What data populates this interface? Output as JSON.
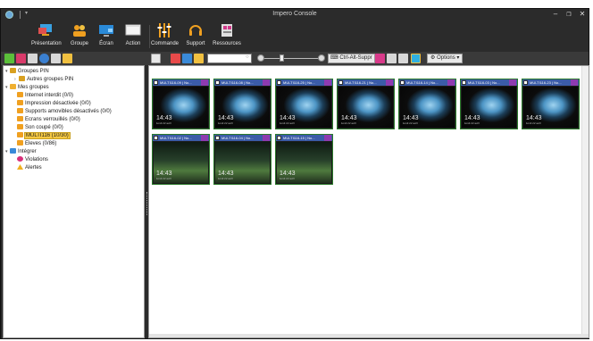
{
  "window": {
    "title": "Impero Console",
    "menu_glyph": "▾",
    "minimize": "–",
    "restore": "❐",
    "close": "✕"
  },
  "ribbon": {
    "buttons": [
      {
        "label": "Présentation",
        "icon": "presentation-icon"
      },
      {
        "label": "Groupe",
        "icon": "group-icon"
      },
      {
        "label": "Écran",
        "icon": "screen-icon"
      },
      {
        "label": "Action",
        "icon": "action-icon"
      },
      {
        "label": "Commande",
        "icon": "command-icon"
      },
      {
        "label": "Support",
        "icon": "support-headset-icon"
      },
      {
        "label": "Ressources",
        "icon": "resources-icon"
      }
    ]
  },
  "toolbar": {
    "ctrl_alt_label": "Ctrl-Alt-Suppr",
    "options_label": "Options",
    "options_caret": "▾",
    "search_placeholder": "",
    "search_clear": "○"
  },
  "tree": {
    "items": [
      {
        "label": "Groupes PIN",
        "level": 0,
        "expanded": true,
        "icon": "pin-group-icon"
      },
      {
        "label": "Autres groupes PIN",
        "level": 1,
        "expanded": false,
        "icon": "pin-group-icon"
      },
      {
        "label": "Mes groupes",
        "level": 0,
        "expanded": true,
        "icon": "folder-group-icon"
      },
      {
        "label": "Internet interdit (0/0)",
        "level": 1,
        "icon": "group-users-icon"
      },
      {
        "label": "Impression désactivée (0/0)",
        "level": 1,
        "icon": "group-users-icon"
      },
      {
        "label": "Supports amovibles désactivés (0/0)",
        "level": 1,
        "icon": "group-users-icon"
      },
      {
        "label": "Ecrans verrouillés (0/0)",
        "level": 1,
        "icon": "group-users-icon"
      },
      {
        "label": "Son coupé (0/0)",
        "level": 1,
        "icon": "group-users-icon"
      },
      {
        "label": "MULTI116 (10/30)",
        "level": 1,
        "icon": "group-users-icon",
        "selected": true
      },
      {
        "label": "Eleves (0/86)",
        "level": 1,
        "icon": "group-users-icon"
      },
      {
        "label": "Intégrer",
        "level": 0,
        "expanded": true,
        "icon": "integrate-icon"
      },
      {
        "label": "Violations",
        "level": 1,
        "icon": "violation-icon"
      },
      {
        "label": "Alertes",
        "level": 1,
        "icon": "alert-icon"
      }
    ]
  },
  "thumbnails": [
    {
      "label": "MULTI116-09 | No...",
      "time": "14:43",
      "date": "lundi 22 avril",
      "wallpaper": "cave"
    },
    {
      "label": "MULTI116-08 | No...",
      "time": "14:43",
      "date": "lundi 22 avril",
      "wallpaper": "cave"
    },
    {
      "label": "MULTI116-25 | No...",
      "time": "14:43",
      "date": "lundi 22 avril",
      "wallpaper": "cave"
    },
    {
      "label": "MULTI116-21 | No...",
      "time": "14:43",
      "date": "lundi 22 avril",
      "wallpaper": "cave"
    },
    {
      "label": "MULTI116-14 | No...",
      "time": "14:43",
      "date": "lundi 22 avril",
      "wallpaper": "cave"
    },
    {
      "label": "MULTI116-03 | No...",
      "time": "14:43",
      "date": "lundi 22 avril",
      "wallpaper": "cave"
    },
    {
      "label": "MULTI116-23 | No...",
      "time": "14:43",
      "date": "lundi 22 avril",
      "wallpaper": "cave"
    },
    {
      "label": "MULTI116-02 | No...",
      "time": "14:43",
      "date": "lundi 22 avril",
      "wallpaper": "forest"
    },
    {
      "label": "MULTI116-04 | No...",
      "time": "14:43",
      "date": "lundi 22 avril",
      "wallpaper": "forest"
    },
    {
      "label": "MULTI116-15 | No...",
      "time": "14:43",
      "date": "lundi 22 avril",
      "wallpaper": "forest"
    }
  ]
}
